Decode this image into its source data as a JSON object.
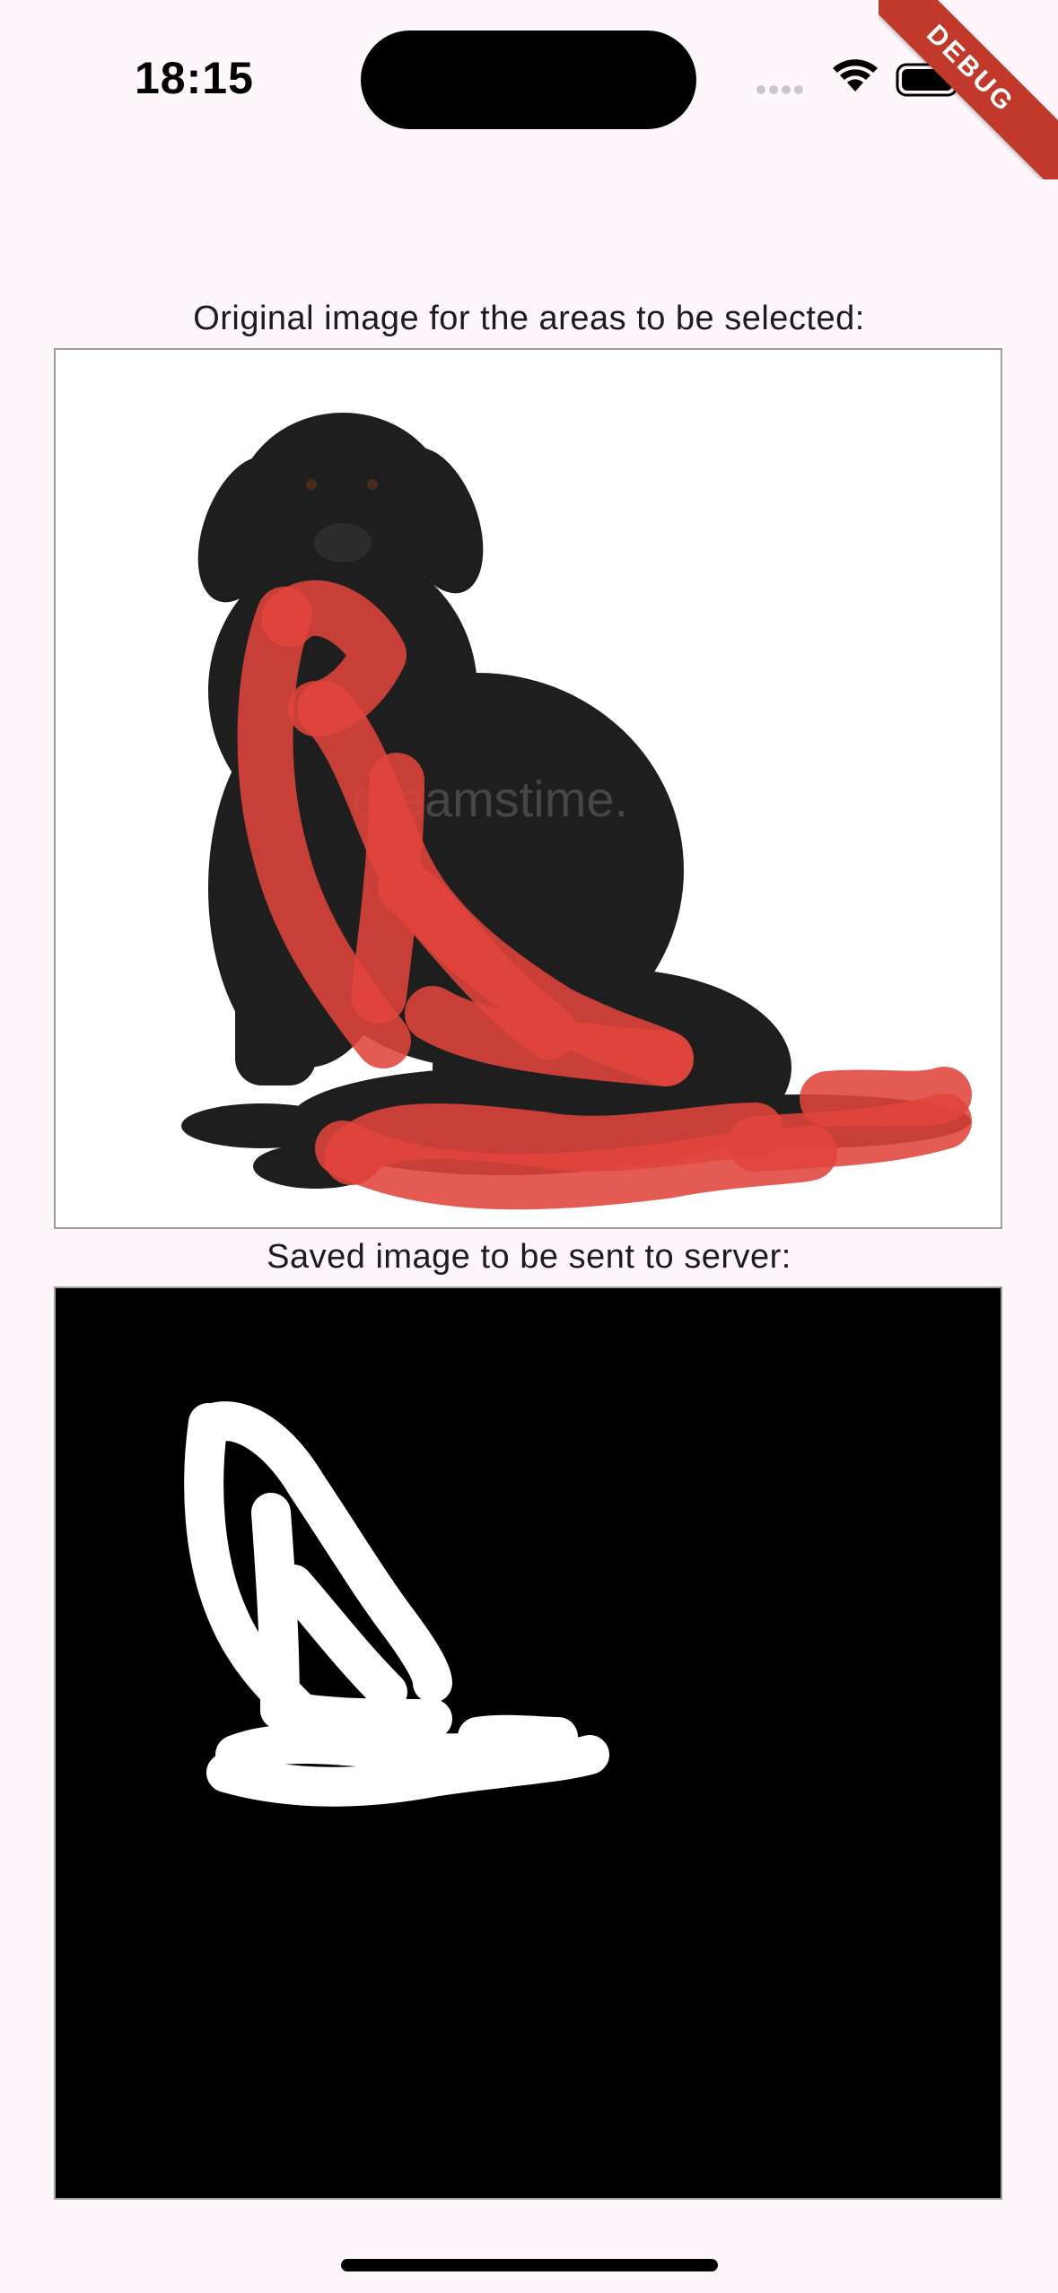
{
  "status_bar": {
    "time": "18:15",
    "icons": [
      "signal-dots-icon",
      "wifi-icon",
      "battery-icon"
    ]
  },
  "debug_banner": {
    "label": "DEBUG"
  },
  "original_section": {
    "caption": "Original image for the areas to be selected:",
    "watermark": "dreamstime.",
    "brush_color": "#e0443c"
  },
  "saved_section": {
    "caption": "Saved image to be sent to server:",
    "mask_background": "#000000",
    "mask_color": "#ffffff"
  }
}
